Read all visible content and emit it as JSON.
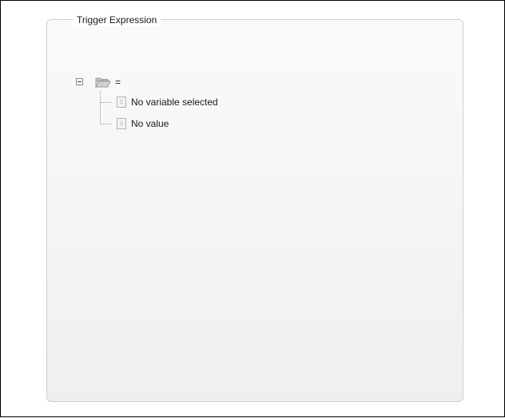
{
  "panel": {
    "title": "Trigger Expression"
  },
  "tree": {
    "root": {
      "label": "=",
      "icon": "folder-open-icon",
      "expanded": true
    },
    "children": [
      {
        "label": "No variable selected",
        "icon": "document-icon"
      },
      {
        "label": "No value",
        "icon": "document-icon"
      }
    ]
  }
}
